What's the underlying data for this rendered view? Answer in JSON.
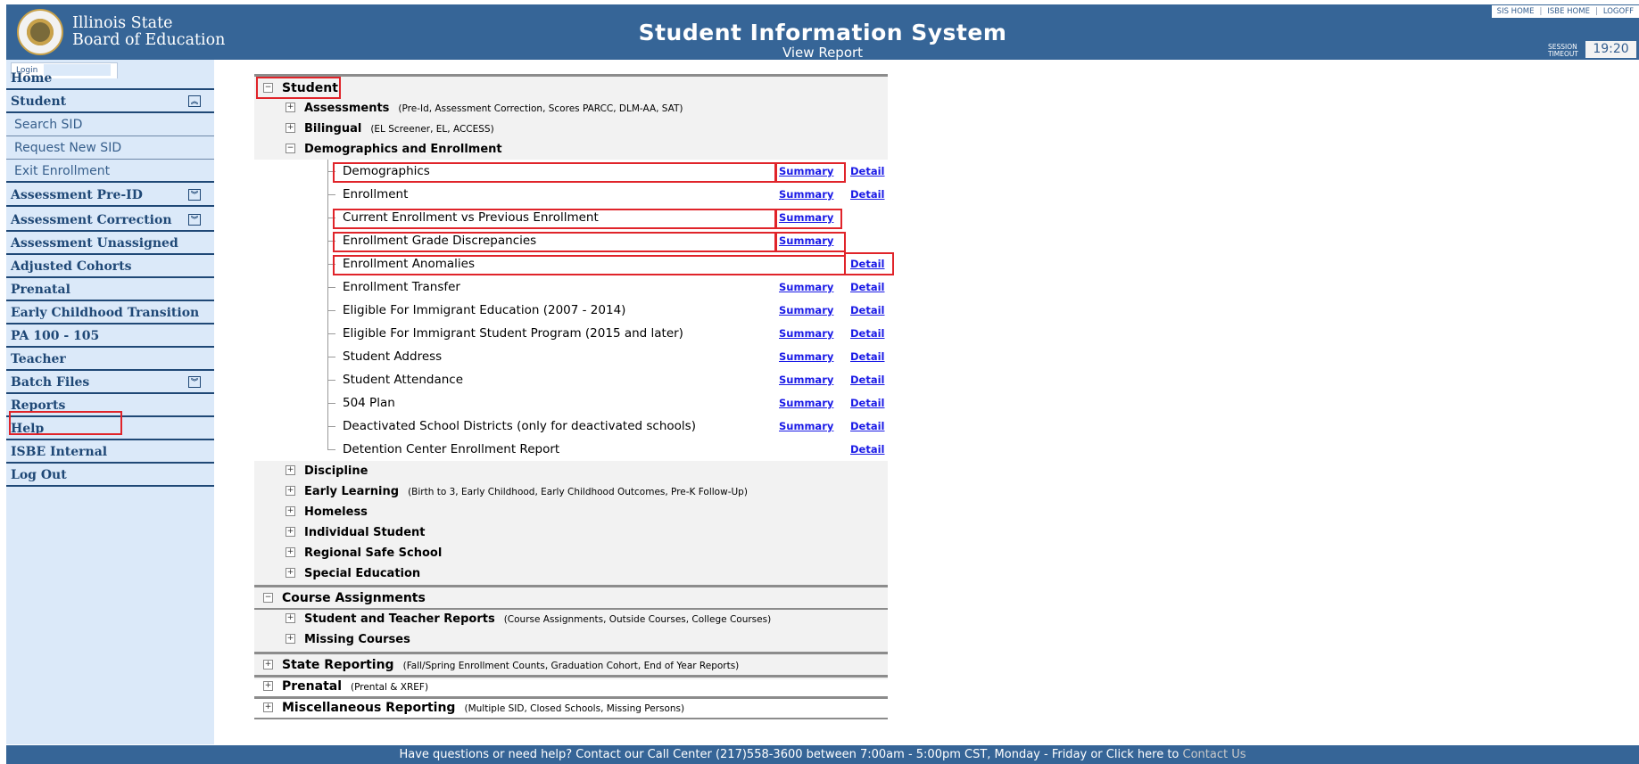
{
  "header": {
    "logo_line1": "Illinois State",
    "logo_line2": "Board of Education",
    "title": "Student Information System",
    "subtitle": "View Report",
    "links": [
      "SIS HOME",
      "ISBE HOME",
      "LOGOFF"
    ],
    "session_label_1": "SESSION",
    "session_label_2": "TIMEOUT",
    "session_time": "19:20"
  },
  "sidebar": {
    "login": "Login",
    "items": [
      {
        "label": "Home"
      },
      {
        "label": "Student"
      },
      {
        "label": "Search SID"
      },
      {
        "label": "Request New SID"
      },
      {
        "label": "Exit Enrollment"
      },
      {
        "label": "Assessment Pre-ID"
      },
      {
        "label": "Assessment Correction"
      },
      {
        "label": "Assessment Unassigned"
      },
      {
        "label": "Adjusted Cohorts"
      },
      {
        "label": "Prenatal"
      },
      {
        "label": "Early Childhood Transition"
      },
      {
        "label": "PA 100 - 105"
      },
      {
        "label": "Teacher"
      },
      {
        "label": "Batch Files"
      },
      {
        "label": "Reports"
      },
      {
        "label": "Help"
      },
      {
        "label": "ISBE Internal"
      },
      {
        "label": "Log Out"
      }
    ]
  },
  "content": {
    "categories": [
      {
        "label": "Student",
        "desc": ""
      },
      {
        "label": "Course Assignments",
        "desc": ""
      },
      {
        "label": "State Reporting",
        "desc": "(Fall/Spring Enrollment Counts, Graduation Cohort, End of Year Reports)"
      },
      {
        "label": "Prenatal",
        "desc": "(Prental & XREF)"
      },
      {
        "label": "Miscellaneous Reporting",
        "desc": "(Multiple SID, Closed Schools, Missing Persons)"
      }
    ],
    "student_subs": [
      {
        "label": "Assessments",
        "desc": "(Pre-Id, Assessment Correction, Scores PARCC, DLM-AA, SAT)"
      },
      {
        "label": "Bilingual",
        "desc": "(EL Screener, EL, ACCESS)"
      },
      {
        "label": "Demographics and Enrollment",
        "desc": ""
      },
      {
        "label": "Discipline",
        "desc": ""
      },
      {
        "label": "Early Learning",
        "desc": "(Birth to 3, Early Childhood, Early Childhood Outcomes, Pre-K Follow-Up)"
      },
      {
        "label": "Homeless",
        "desc": ""
      },
      {
        "label": "Individual Student",
        "desc": ""
      },
      {
        "label": "Regional Safe School",
        "desc": ""
      },
      {
        "label": "Special Education",
        "desc": ""
      }
    ],
    "course_subs": [
      {
        "label": "Student and Teacher Reports",
        "desc": "(Course Assignments, Outside Courses, College Courses)"
      },
      {
        "label": "Missing Courses",
        "desc": ""
      }
    ],
    "summary_label": "Summary",
    "detail_label": "Detail",
    "reports": [
      {
        "name": "Demographics"
      },
      {
        "name": "Enrollment"
      },
      {
        "name": "Current Enrollment vs Previous Enrollment"
      },
      {
        "name": "Enrollment Grade Discrepancies"
      },
      {
        "name": "Enrollment Anomalies"
      },
      {
        "name": "Enrollment Transfer"
      },
      {
        "name": "Eligible For Immigrant Education (2007 - 2014)"
      },
      {
        "name": "Eligible For Immigrant Student Program (2015 and later)"
      },
      {
        "name": "Student Address"
      },
      {
        "name": "Student Attendance"
      },
      {
        "name": "504 Plan"
      },
      {
        "name": "Deactivated School Districts (only for deactivated schools)"
      },
      {
        "name": "Detention Center Enrollment Report"
      }
    ]
  },
  "footer": {
    "text": "Have questions or need help? Contact our Call Center (217)558-3600 between 7:00am - 5:00pm CST, Monday - Friday or Click here to ",
    "contact": "Contact Us"
  },
  "colors": {
    "brand": "#366597",
    "sidebar_bg": "#dbe9f9",
    "link": "#1a1ae6",
    "highlight": "#e0242a"
  }
}
